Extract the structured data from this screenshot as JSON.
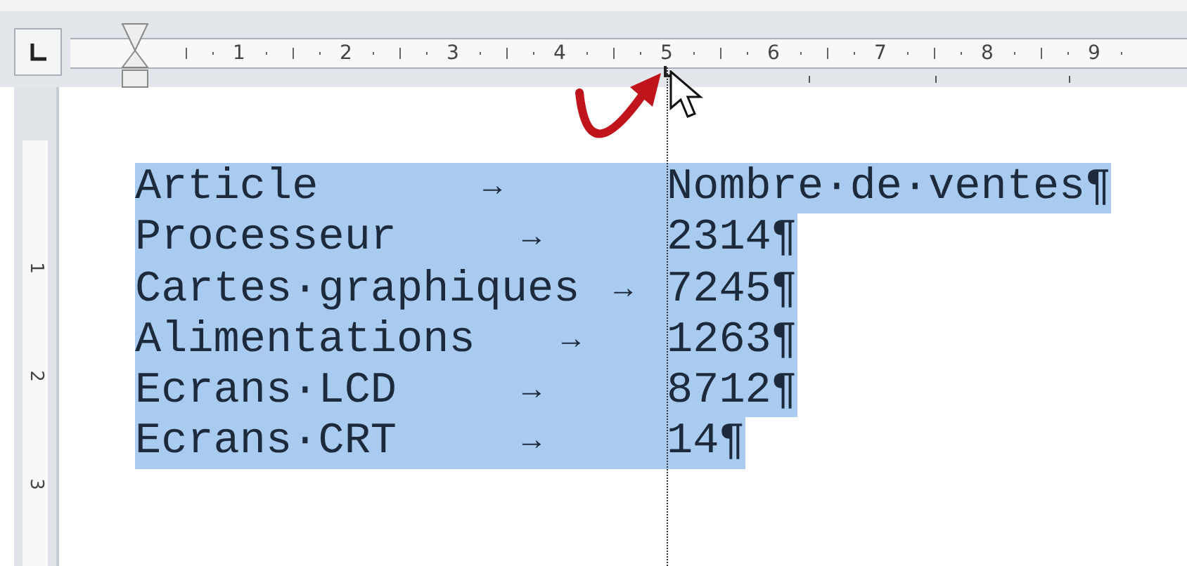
{
  "ruler": {
    "labels": [
      "1",
      "2",
      "3",
      "4",
      "5",
      "6",
      "7",
      "8",
      "9"
    ]
  },
  "vertical_ruler": {
    "labels": [
      "1",
      "2",
      "3"
    ]
  },
  "rows": [
    {
      "label": "Article",
      "tab": "→",
      "value": "Nombre·de·ventes¶",
      "selected": true
    },
    {
      "label": "Processeur",
      "tab": "→",
      "value": "2314¶",
      "selected": true
    },
    {
      "label": "Cartes·graphiques",
      "tab": "→",
      "value": "7245¶",
      "selected": true
    },
    {
      "label": "Alimentations",
      "tab": "→",
      "value": "1263¶",
      "selected": true
    },
    {
      "label": "Ecrans·LCD",
      "tab": "→",
      "value": "8712¶",
      "selected": true
    },
    {
      "label": "Ecrans·CRT",
      "tab": "→",
      "value": "14¶",
      "selected": true
    }
  ]
}
